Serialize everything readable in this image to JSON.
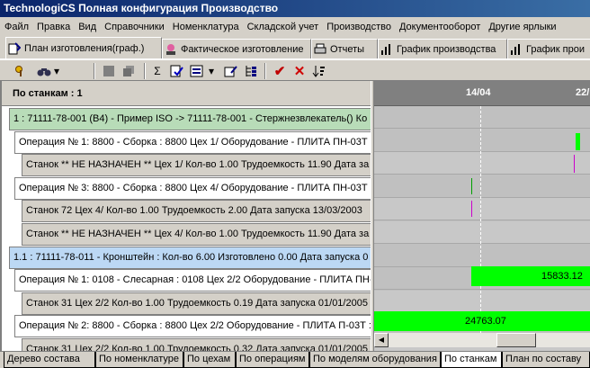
{
  "window": {
    "title": "TechnologiCS Полная конфигурация Производство"
  },
  "menu": [
    "Файл",
    "Правка",
    "Вид",
    "Справочники",
    "Номенклатура",
    "Складской учет",
    "Производство",
    "Документооборот",
    "Другие ярлыки"
  ],
  "tabs": [
    {
      "label": "План изготовления(граф.)",
      "icon": "plan-icon",
      "active": true
    },
    {
      "label": "Фактическое изготовление",
      "icon": "worker-icon"
    },
    {
      "label": "Отчеты",
      "icon": "printer-icon"
    },
    {
      "label": "График производства",
      "icon": "chart-icon"
    },
    {
      "label": "График прои",
      "icon": "chart-icon"
    }
  ],
  "toolbar": [
    "key-icon",
    "binoculars-icon",
    "dropdown-arrow-icon",
    "stop-icon",
    "copy-icon",
    "sum-icon",
    "check-doc-icon",
    "filter-icon",
    "dropdown-arrow-icon",
    "edit-icon",
    "tree-icon",
    "checkmark-icon",
    "cross-icon",
    "sort-icon"
  ],
  "left_panel": {
    "header": "По станкам : 1",
    "rows": [
      {
        "text": "1 : 71111-78-001 (В4) - Пример ISO -> 71111-78-001 - Стержнезвлекатель() Ко",
        "style": "green",
        "indent": 8
      },
      {
        "text": "Операция № 1: 8800 - Сборка : 8800 Цех 1/ Оборудование - ПЛИТА ПН-03Т :",
        "style": "white",
        "indent": 14
      },
      {
        "text": "Станок ** НЕ НАЗНАЧЕН ** Цех 1/ Кол-во 1.00 Трудоемкость 11.90 Дата за",
        "style": "grey",
        "indent": 22
      },
      {
        "text": "Операция № 3: 8800 - Сборка : 8800 Цех 4/ Оборудование - ПЛИТА ПН-03Т :",
        "style": "white",
        "indent": 14
      },
      {
        "text": "Станок 72 Цех 4/ Кол-во 1.00 Трудоемкость 2.00 Дата запуска 13/03/2003",
        "style": "grey",
        "indent": 22
      },
      {
        "text": "Станок ** НЕ НАЗНАЧЕН ** Цех 4/ Кол-во 1.00 Трудоемкость 11.90 Дата за",
        "style": "grey",
        "indent": 22
      },
      {
        "text": "1.1 : 71111-78-011 - Кронштейн : Кол-во 6.00 Изготовлено 0.00 Дата запуска 0",
        "style": "blue",
        "indent": 8
      },
      {
        "text": "Операция № 1: 0108 - Слесарная : 0108 Цех 2/2 Оборудование - ПЛИТА ПН-0",
        "style": "white",
        "indent": 14
      },
      {
        "text": "Станок 31 Цех 2/2 Кол-во 1.00 Трудоемкость 0.19 Дата запуска 01/01/2005",
        "style": "grey",
        "indent": 22
      },
      {
        "text": "Операция № 2: 8800 - Сборка : 8800 Цех 2/2 Оборудование - ПЛИТА П-03Т :",
        "style": "white",
        "indent": 14
      },
      {
        "text": "Станок 31 Цех 2/2 Кол-во 1.00 Трудоемкость 0.32 Дата запуска 01/01/2005",
        "style": "grey",
        "indent": 22
      }
    ]
  },
  "gantt": {
    "dates": [
      "14/04",
      "22/"
    ],
    "values": [
      "15833.12",
      "24763.07"
    ]
  },
  "bottom_tabs": [
    "Дерево состава",
    "По номенклатуре",
    "По цехам",
    "По операциям",
    "По моделям оборудования",
    "По станкам",
    "План по составу"
  ],
  "bottom_active": "По станкам",
  "colors": {
    "titlebar": "#0a246a",
    "bar": "#00ff00",
    "row_green": "#b8dcb8",
    "row_blue": "#bcd8f4",
    "mark": "#cc00cc"
  }
}
